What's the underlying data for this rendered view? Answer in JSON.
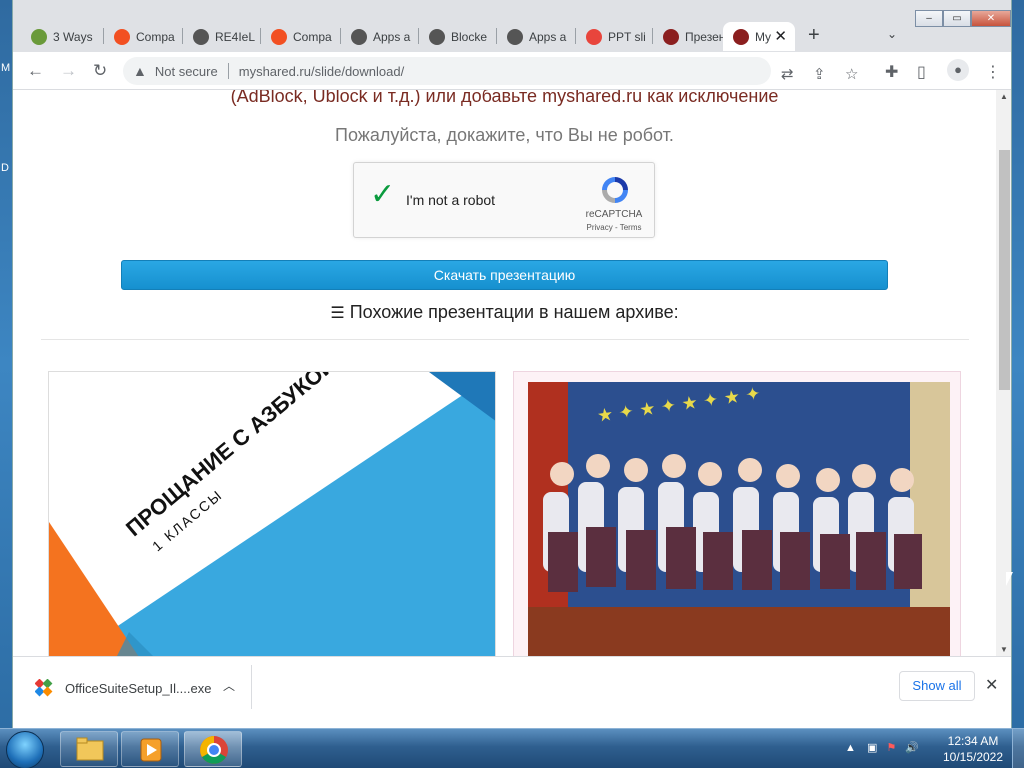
{
  "browser": {
    "tabs": [
      {
        "title": "3 Ways",
        "favicon_color": "#6a9a3a"
      },
      {
        "title": "Compa",
        "favicon_color": "#f25022"
      },
      {
        "title": "RE4IeL",
        "favicon_color": "#555555"
      },
      {
        "title": "Compa",
        "favicon_color": "#f25022"
      },
      {
        "title": "Apps a",
        "favicon_color": "#555555"
      },
      {
        "title": "Blocke",
        "favicon_color": "#555555"
      },
      {
        "title": "Apps a",
        "favicon_color": "#555555"
      },
      {
        "title": "PPT sli",
        "favicon_color": "#e8453c"
      },
      {
        "title": "Презен",
        "favicon_color": "#8b1f1f"
      },
      {
        "title": "My",
        "favicon_color": "#8b1f1f",
        "active": true
      }
    ],
    "new_tab_label": "+",
    "tab_search_icon": "chevron-down-icon",
    "address": {
      "security_label": "Not secure",
      "url": "myshared.ru/slide/download/"
    }
  },
  "page": {
    "adblock_notice": "(AdBlock, Ublock и т.д.) или добавьте myshared.ru как исключение",
    "robot_prompt": "Пожалуйста, докажите, что Вы не робот.",
    "captcha": {
      "label": "I'm not a robot",
      "brand": "reCAPTCHA",
      "terms": "Privacy - Terms",
      "checked": true
    },
    "download_button": "Скачать презентацию",
    "similar_heading": "Похожие презентации в нашем архиве:",
    "cards": [
      {
        "title": "ПРОЩАНИЕ С АЗБУКОЙ",
        "subtitle": "1 КЛАССЫ"
      },
      {
        "kind": "photo"
      }
    ]
  },
  "downloads_bar": {
    "filename": "OfficeSuiteSetup_Il....exe",
    "show_all": "Show all"
  },
  "taskbar": {
    "time": "12:34 AM",
    "date": "10/15/2022"
  },
  "colors": {
    "accent_button": "#1a9ad8",
    "adblock_text": "#7a2b22",
    "link_blue": "#1a73e8"
  }
}
